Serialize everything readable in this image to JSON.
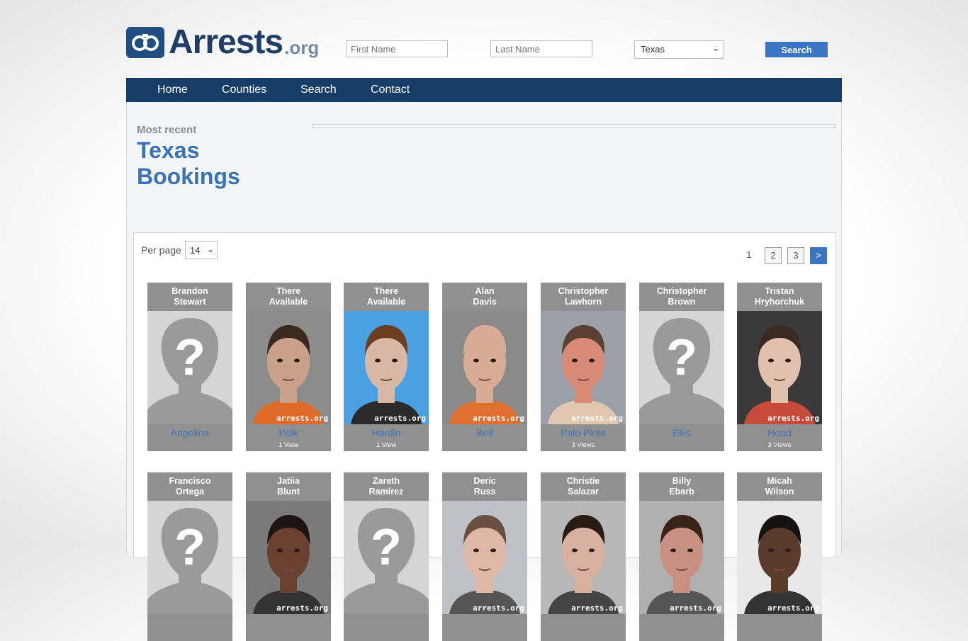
{
  "header": {
    "logo_main": "Arrests",
    "logo_tld": ".org",
    "first_name_placeholder": "First Name",
    "last_name_placeholder": "Last Name",
    "state_selected": "Texas",
    "search_label": "Search"
  },
  "nav": [
    "Home",
    "Counties",
    "Search",
    "Contact"
  ],
  "intro": {
    "most_recent": "Most recent",
    "title_line1": "Texas",
    "title_line2": "Bookings"
  },
  "listing": {
    "per_page_label": "Per page",
    "per_page_value": "14",
    "pages": [
      "1",
      "2",
      "3"
    ],
    "current_page": "1",
    "next_label": ">"
  },
  "colors": {
    "nav": "#173c66",
    "accent": "#3a75c4",
    "county_link": "#3f73b8",
    "card_bg": "#909090"
  },
  "cards": [
    {
      "first": "Brandon",
      "last": "Stewart",
      "county": "Angelina",
      "views": "",
      "photo": "unknown",
      "bg": "#d5d5d5"
    },
    {
      "first": "There",
      "last": "Available",
      "county": "Polk",
      "views": "1 View",
      "photo": "mugshot",
      "bg": "#6b5a4e",
      "skin": "#c9a08a",
      "hair": "#3a2a20",
      "shirt": "#e06a2a",
      "wall": "#8c8c8c"
    },
    {
      "first": "There",
      "last": "Available",
      "county": "Hardin",
      "views": "1 View",
      "photo": "mugshot",
      "bg": "#4aa0e0",
      "skin": "#d9b7a6",
      "hair": "#6b3e22",
      "shirt": "#2a2a2a",
      "wall": "#4aa0e0"
    },
    {
      "first": "Alan",
      "last": "Davis",
      "county": "Bell",
      "views": "",
      "photo": "mugshot",
      "bg": "#8a8a8a",
      "skin": "#d8ab95",
      "hair": "#d8ab95",
      "shirt": "#e07030",
      "wall": "#8a8a8a"
    },
    {
      "first": "Christopher",
      "last": "Lawhorn",
      "county": "Palo Pinto",
      "views": "3 Views",
      "photo": "mugshot",
      "bg": "#9a9fa8",
      "skin": "#d88a78",
      "hair": "#5a4030",
      "shirt": "#e0c8b0",
      "wall": "#9a9fa8"
    },
    {
      "first": "Christopher",
      "last": "Brown",
      "county": "Ellis",
      "views": "",
      "photo": "unknown",
      "bg": "#d5d5d5"
    },
    {
      "first": "Tristan",
      "last": "Hryhorchuk",
      "county": "Hood",
      "views": "3 Views",
      "photo": "mugshot",
      "bg": "#2a2a2a",
      "skin": "#e2c0b0",
      "hair": "#3a2a22",
      "shirt": "#c84a3a",
      "wall": "#3a3a3a"
    },
    {
      "first": "Francisco",
      "last": "Ortega",
      "county": "",
      "views": "",
      "photo": "unknown",
      "bg": "#d5d5d5"
    },
    {
      "first": "Jatiia",
      "last": "Blunt",
      "county": "",
      "views": "",
      "photo": "mugshot",
      "bg": "#7a7a7a",
      "skin": "#6a4030",
      "hair": "#1e1410",
      "shirt": "#333333",
      "wall": "#7a7a7a"
    },
    {
      "first": "Zareth",
      "last": "Ramirez",
      "county": "",
      "views": "",
      "photo": "unknown",
      "bg": "#d5d5d5"
    },
    {
      "first": "Deric",
      "last": "Russ",
      "county": "",
      "views": "",
      "photo": "mugshot",
      "bg": "#c0c0c8",
      "skin": "#e0b8a8",
      "hair": "#6a5040",
      "shirt": "#555555",
      "wall": "#c0c0c8"
    },
    {
      "first": "Christie",
      "last": "Salazar",
      "county": "",
      "views": "",
      "photo": "mugshot",
      "bg": "#b8b8b8",
      "skin": "#d8b0a0",
      "hair": "#2a1a14",
      "shirt": "#444444",
      "wall": "#b8b8b8"
    },
    {
      "first": "Billy",
      "last": "Ebarb",
      "county": "",
      "views": "",
      "photo": "mugshot",
      "bg": "#b0b0b0",
      "skin": "#c89080",
      "hair": "#3a2418",
      "shirt": "#555555",
      "wall": "#b0b0b0"
    },
    {
      "first": "Micah",
      "last": "Wilson",
      "county": "",
      "views": "",
      "photo": "mugshot",
      "bg": "#e0e0e0",
      "skin": "#5a3a2a",
      "hair": "#161010",
      "shirt": "#333333",
      "wall": "#e8e8e8"
    }
  ],
  "watermark": "arrests.org"
}
